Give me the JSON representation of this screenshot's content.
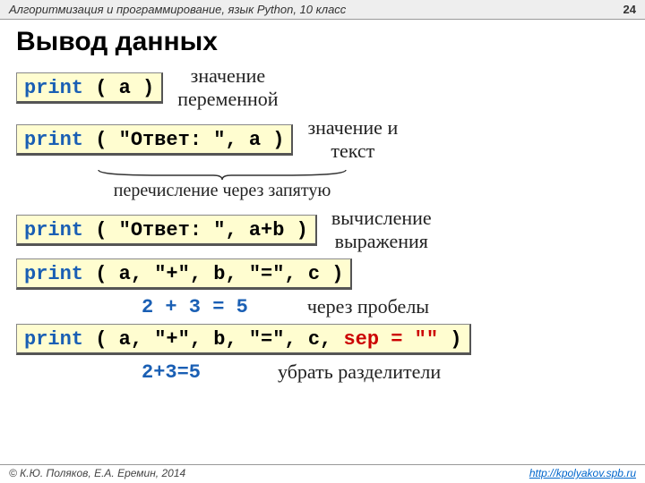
{
  "header": {
    "title": "Алгоритмизация и программирование, язык Python, 10 класс",
    "page": "24"
  },
  "title": "Вывод данных",
  "ex1": {
    "kw": "print",
    "body": " ( a )",
    "label": "значение\nпеременной"
  },
  "ex2": {
    "kw": "print",
    "body": " ( \"Ответ: \", a )",
    "label": "значение и\nтекст",
    "brace": "перечисление через запятую"
  },
  "ex3": {
    "kw": "print",
    "body": " ( \"Ответ: \", a+b )",
    "label": "вычисление\nвыражения"
  },
  "ex4": {
    "kw": "print",
    "body": " ( a, \"+\", b, \"=\", c )",
    "result": "2 + 3 = 5",
    "label": "через пробелы"
  },
  "ex5": {
    "kw": "print",
    "body_pre": " ( a, \"+\", b, \"=\", c, ",
    "sep": "sep = \"\"",
    "body_post": " )",
    "result": "2+3=5",
    "label": "убрать разделители"
  },
  "footer": {
    "copyright": "© К.Ю. Поляков, Е.А. Еремин, 2014",
    "url": "http://kpolyakov.spb.ru"
  }
}
